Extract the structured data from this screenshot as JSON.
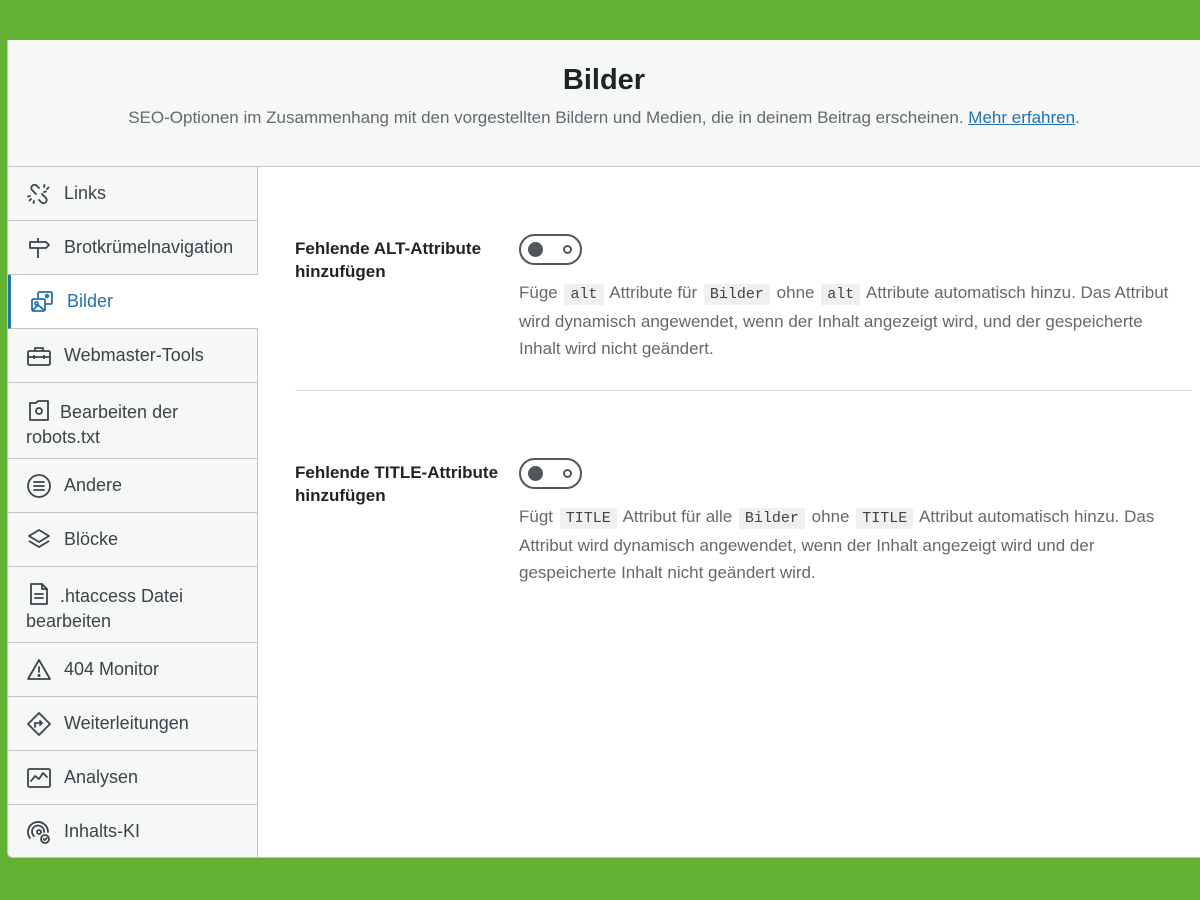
{
  "header": {
    "title": "Bilder",
    "description": "SEO-Optionen im Zusammenhang mit den vorgestellten Bildern und Medien, die in deinem Beitrag erscheinen.",
    "link_text": "Mehr erfahren",
    "link_suffix": "."
  },
  "sidebar": {
    "items": [
      {
        "label": "Links",
        "icon": "broken-link-icon"
      },
      {
        "label": "Brotkrümelnavigation",
        "icon": "signpost-icon"
      },
      {
        "label": "Bilder",
        "icon": "images-icon",
        "active": true
      },
      {
        "label": "Webmaster-Tools",
        "icon": "toolbox-icon"
      },
      {
        "label_line1": "Bearbeiten der",
        "label_line2": "robots.txt",
        "icon": "robots-file-icon"
      },
      {
        "label": "Andere",
        "icon": "list-circle-icon"
      },
      {
        "label": "Blöcke",
        "icon": "blocks-icon"
      },
      {
        "label_line1": ".htaccess Datei",
        "label_line2": "bearbeiten",
        "icon": "document-icon"
      },
      {
        "label": "404 Monitor",
        "icon": "warning-icon"
      },
      {
        "label": "Weiterleitungen",
        "icon": "redirect-icon"
      },
      {
        "label": "Analysen",
        "icon": "analytics-icon"
      },
      {
        "label": "Inhalts-KI",
        "icon": "content-ai-icon"
      }
    ]
  },
  "settings": [
    {
      "label_line1": "Fehlende ALT-Attribute",
      "label_line2": "hinzufügen",
      "enabled": false,
      "desc": {
        "t1": "Füge",
        "c1": "alt",
        "t2": "Attribute für",
        "c2": "Bilder",
        "t3": "ohne",
        "c3": "alt",
        "t4": "Attribute automatisch hinzu. Das Attribut wird dynamisch angewendet, wenn der Inhalt angezeigt wird, und der gespeicherte Inhalt wird nicht geändert."
      }
    },
    {
      "label_line1": "Fehlende TITLE-Attribute",
      "label_line2": "hinzufügen",
      "enabled": false,
      "desc": {
        "t1": "Fügt",
        "c1": "TITLE",
        "t2": "Attribut für alle",
        "c2": "Bilder",
        "t3": "ohne",
        "c3": "TITLE",
        "t4": "Attribut automatisch hinzu. Das Attribut wird dynamisch angewendet, wenn der Inhalt angezeigt wird und der gespeicherte Inhalt nicht geändert wird."
      }
    }
  ],
  "colors": {
    "frame": "#62b132",
    "accent": "#2271b1",
    "text": "#1d2327",
    "muted": "#646970"
  }
}
